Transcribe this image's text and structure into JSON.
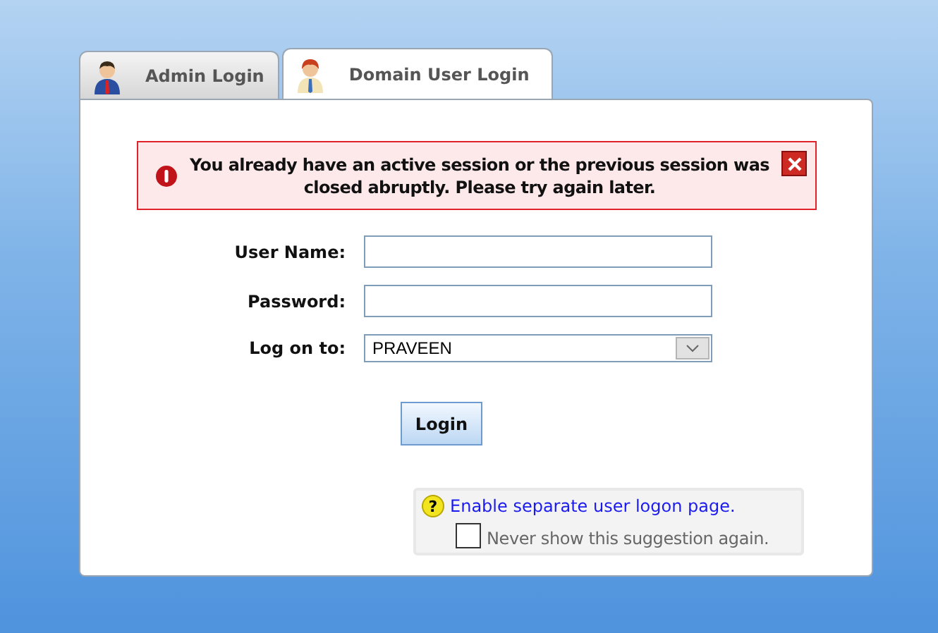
{
  "tabs": [
    {
      "label": "Admin Login",
      "selected": false
    },
    {
      "label": "Domain User Login",
      "selected": true
    }
  ],
  "error": {
    "message": "You already have an active session or the previous session was closed abruptly. Please try again later."
  },
  "form": {
    "fields": [
      {
        "kind": "text",
        "label": "User Name:"
      },
      {
        "kind": "text",
        "label": "Password:"
      },
      {
        "kind": "select",
        "label": "Log on to:",
        "value": "PRAVEEN"
      }
    ],
    "button": "Login"
  },
  "suggestion": {
    "icon": "?",
    "link": "Enable separate user logon page.",
    "checkbox": {
      "label": "Never show this suggestion again.",
      "checked": false
    }
  }
}
